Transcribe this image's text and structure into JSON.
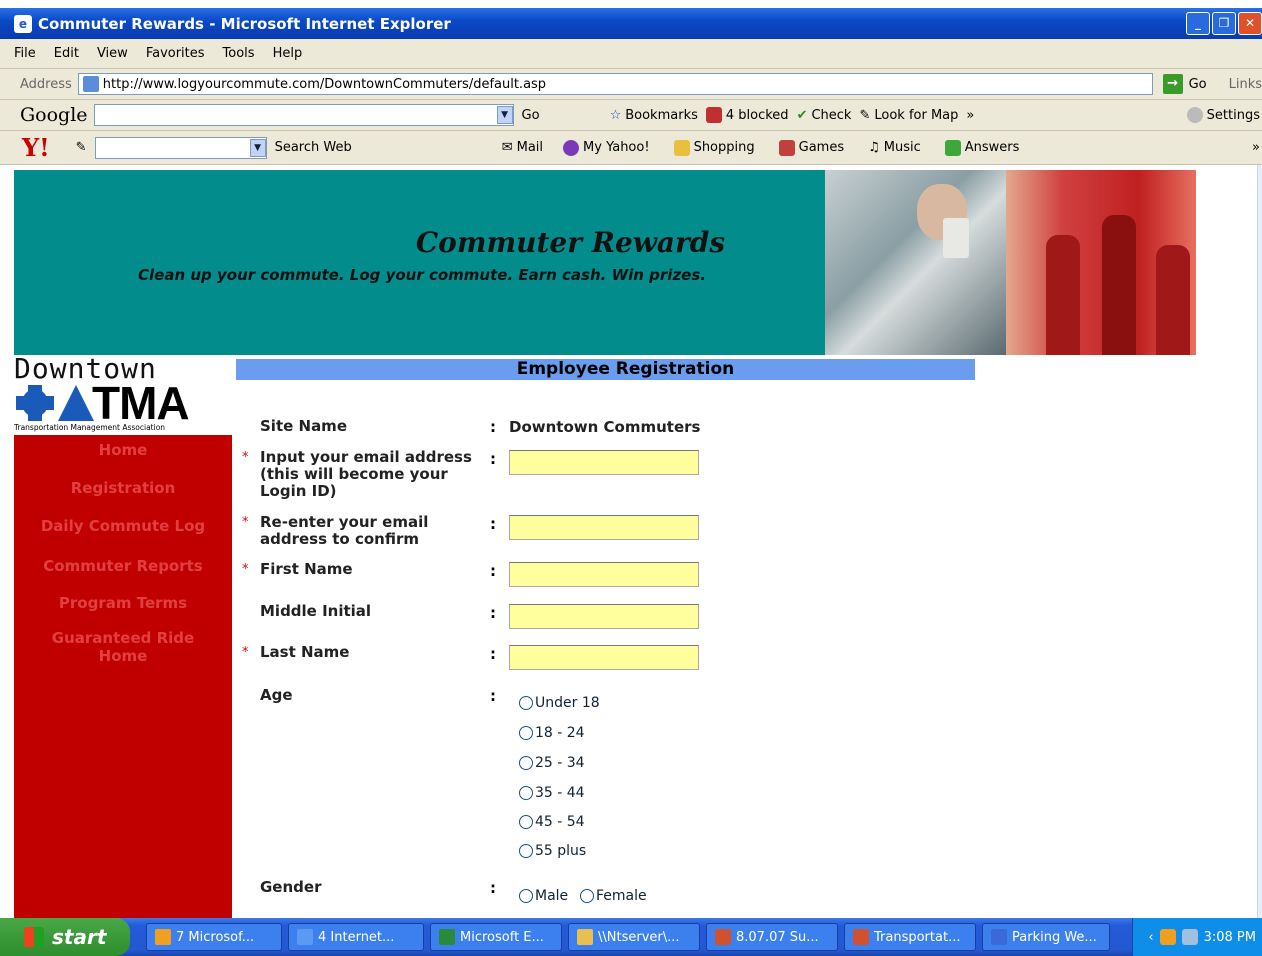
{
  "window": {
    "title": "Commuter Rewards - Microsoft Internet Explorer"
  },
  "menu": [
    "File",
    "Edit",
    "View",
    "Favorites",
    "Tools",
    "Help"
  ],
  "address": {
    "label": "Address",
    "url": "http://www.logyourcommute.com/DowntownCommuters/default.asp",
    "go": "Go",
    "links": "Links"
  },
  "google_toolbar": {
    "logo": "Google",
    "go": "Go",
    "bookmarks": "Bookmarks",
    "blocked": "4 blocked",
    "check": "Check",
    "look_for_map": "Look for Map",
    "more": "»",
    "settings": "Settings"
  },
  "yahoo_toolbar": {
    "logo": "Y!",
    "search_web": "Search Web",
    "mail": "Mail",
    "my_yahoo": "My Yahoo!",
    "shopping": "Shopping",
    "games": "Games",
    "music": "Music",
    "answers": "Answers",
    "more": "»"
  },
  "banner": {
    "title": "Commuter Rewards",
    "tagline": "Clean up your commute. Log your commute. Earn cash. Win prizes."
  },
  "logo": {
    "top": "Downtown",
    "main": "TMA",
    "sub": "Transportation Management Association"
  },
  "sidebar": {
    "items": [
      "Home",
      "Registration",
      "Daily Commute Log",
      "Commuter Reports",
      "Program Terms",
      "Guaranteed Ride Home"
    ]
  },
  "form": {
    "header": "Employee Registration",
    "site_name_label": "Site Name",
    "site_name_value": "Downtown Commuters",
    "colon": ":",
    "required_marker": "*",
    "email_label": "Input your email address (this will become your Login ID)",
    "email_value": "",
    "email_confirm_label": "Re-enter your email address to confirm",
    "email_confirm_value": "",
    "first_name_label": "First Name",
    "first_name_value": "",
    "middle_initial_label": "Middle Initial",
    "middle_initial_value": "",
    "last_name_label": "Last Name",
    "last_name_value": "",
    "age_label": "Age",
    "age_options": [
      "Under 18",
      "18 - 24",
      "25 - 34",
      "35 - 44",
      "45 - 54",
      "55 plus"
    ],
    "gender_label": "Gender",
    "gender_options": [
      "Male",
      "Female"
    ]
  },
  "taskbar": {
    "start": "start",
    "tasks": [
      "7 Microsof...",
      "4 Internet...",
      "Microsoft E...",
      "\\\\Ntserver\\...",
      "8.07.07 Su...",
      "Transportat...",
      "Parking We..."
    ],
    "clock": "3:08 PM"
  },
  "colors": {
    "banner": "#028c8c",
    "sidebar": "#c00000",
    "sidebar_link": "#e24040",
    "header_bar": "#6a9cf0",
    "input_bg": "#ffff9e",
    "required": "#e00000"
  }
}
